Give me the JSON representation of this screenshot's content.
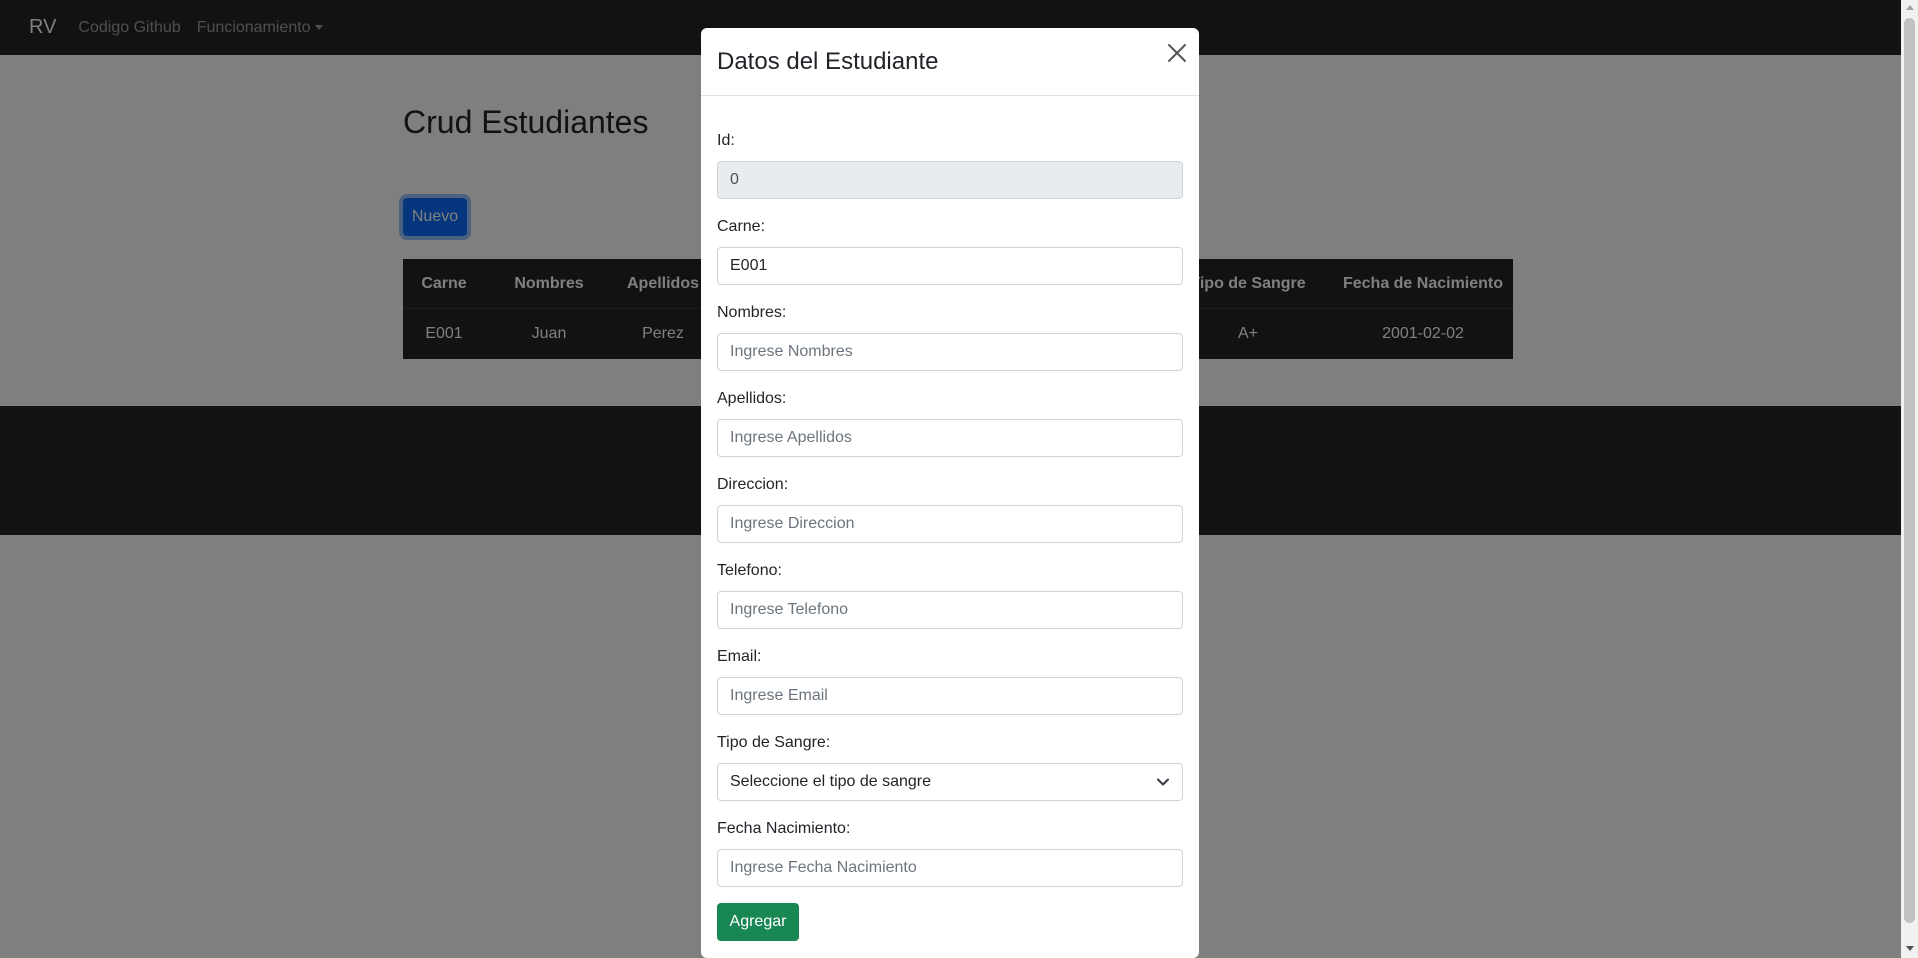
{
  "navbar": {
    "brand": "RV",
    "links": [
      "Codigo Github",
      "Funcionamiento"
    ]
  },
  "main": {
    "title": "Crud Estudiantes",
    "new_button": "Nuevo",
    "table": {
      "headers": [
        "Carne",
        "Nombres",
        "Apellidos",
        "Tipo de Sangre",
        "Fecha de Nacimiento"
      ],
      "rows": [
        [
          "E001",
          "Juan",
          "Perez",
          "A+",
          "2001-02-02"
        ]
      ]
    }
  },
  "modal": {
    "title": "Datos del Estudiante",
    "fields": {
      "id": {
        "label": "Id:",
        "value": "0"
      },
      "carne": {
        "label": "Carne:",
        "value": "E001"
      },
      "nombres": {
        "label": "Nombres:",
        "placeholder": "Ingrese Nombres"
      },
      "apellidos": {
        "label": "Apellidos:",
        "placeholder": "Ingrese Apellidos"
      },
      "direccion": {
        "label": "Direccion:",
        "placeholder": "Ingrese Direccion"
      },
      "telefono": {
        "label": "Telefono:",
        "placeholder": "Ingrese Telefono"
      },
      "email": {
        "label": "Email:",
        "placeholder": "Ingrese Email"
      },
      "tipo_sangre": {
        "label": "Tipo de Sangre:",
        "selected": "Seleccione el tipo de sangre"
      },
      "fecha": {
        "label": "Fecha Nacimiento:",
        "placeholder": "Ingrese Fecha Nacimiento"
      }
    },
    "submit_label": "Agregar"
  },
  "colors": {
    "navbar": "#212529",
    "primary": "#0d6efd",
    "success": "#198754"
  }
}
